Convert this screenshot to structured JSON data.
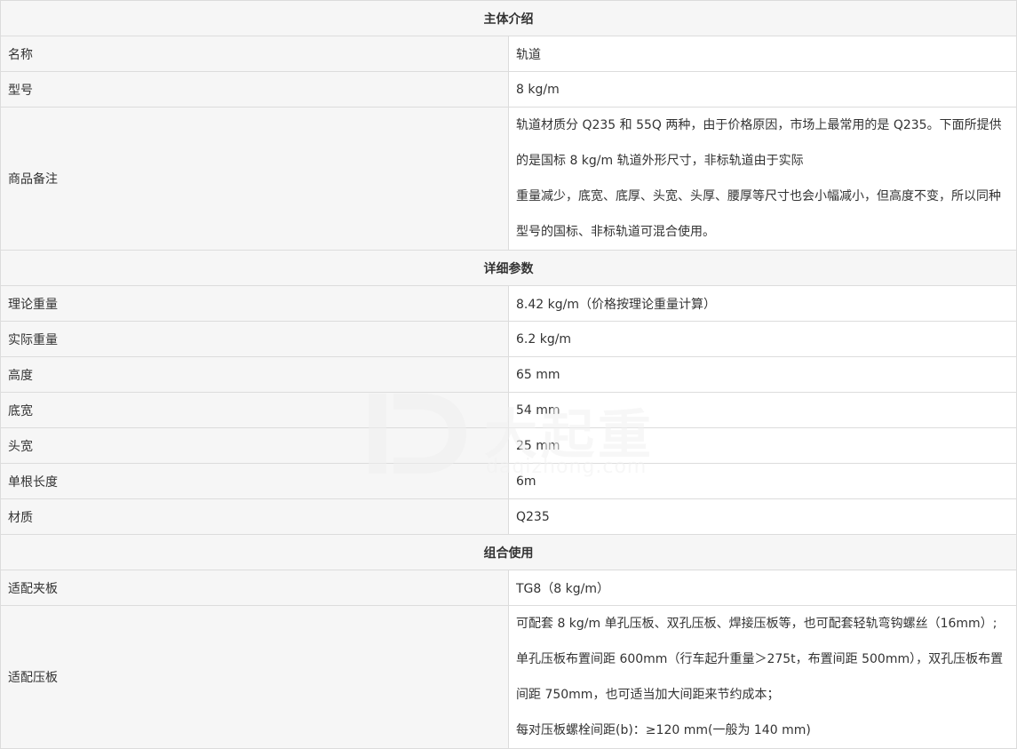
{
  "section_intro": "主体介绍",
  "intro": [
    {
      "label": "名称",
      "value": "轨道"
    },
    {
      "label": "型号",
      "value": "8 kg/m"
    },
    {
      "label": "商品备注",
      "lines": [
        "轨道材质分 Q235 和 55Q 两种，由于价格原因，市场上最常用的是 Q235。下面所提供的是国标 8  kg/m 轨道外形尺寸，非标轨道由于实际",
        "重量减少，底宽、底厚、头宽、头厚、腰厚等尺寸也会小幅减小，但高度不变，所以同种型号的国标、非标轨道可混合使用。"
      ]
    }
  ],
  "section_params": "详细参数",
  "params": [
    {
      "label": "理论重量",
      "value": "8.42 kg/m（价格按理论重量计算）"
    },
    {
      "label": "实际重量",
      "value": "6.2 kg/m"
    },
    {
      "label": "高度",
      "value": "65 mm"
    },
    {
      "label": "底宽",
      "value": "54 mm"
    },
    {
      "label": "头宽",
      "value": "25 mm"
    },
    {
      "label": "单根长度",
      "value": "6m"
    },
    {
      "label": "材质",
      "value": "Q235"
    }
  ],
  "section_combo": "组合使用",
  "combo": [
    {
      "label": "适配夹板",
      "value": "TG8（8 kg/m）"
    },
    {
      "label": "适配压板",
      "lines": [
        "可配套 8 kg/m 单孔压板、双孔压板、焊接压板等，也可配套轻轨弯钩螺丝（16mm）;",
        "单孔压板布置间距 600mm（行车起升重量＞275t，布置间距 500mm），双孔压板布置间距 750mm，也可适当加大间距来节约成本；",
        "每对压板螺栓间距(b)：≥120 mm(一般为 140 mm)"
      ]
    }
  ],
  "watermark": {
    "brand": "大起重",
    "domain": "daqizhong.com"
  }
}
